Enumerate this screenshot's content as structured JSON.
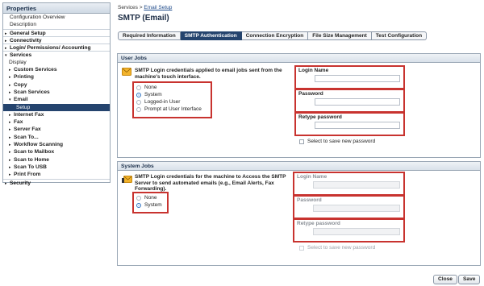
{
  "sidebar": {
    "title": "Properties",
    "items": [
      {
        "label": "Configuration Overview",
        "level": "plain"
      },
      {
        "label": "Description",
        "level": "plain"
      },
      {
        "label": "General Setup",
        "level": "top",
        "marker": "▸"
      },
      {
        "label": "Connectivity",
        "level": "top",
        "marker": "▸"
      },
      {
        "label": "Login/ Permissions/ Accounting",
        "level": "top",
        "marker": "▸"
      },
      {
        "label": "Services",
        "level": "top",
        "marker": "▾"
      },
      {
        "label": "Display",
        "level": "sub"
      },
      {
        "label": "Custom Services",
        "level": "sub-bold",
        "marker": "▸"
      },
      {
        "label": "Printing",
        "level": "sub-bold",
        "marker": "▸"
      },
      {
        "label": "Copy",
        "level": "sub-bold",
        "marker": "▸"
      },
      {
        "label": "Scan Services",
        "level": "sub-bold",
        "marker": "▸"
      },
      {
        "label": "Email",
        "level": "sub-bold",
        "marker": "▾"
      },
      {
        "label": "Setup",
        "level": "subsub-active"
      },
      {
        "label": "Internet Fax",
        "level": "sub-bold",
        "marker": "▸"
      },
      {
        "label": "Fax",
        "level": "sub-bold",
        "marker": "▸"
      },
      {
        "label": "Server Fax",
        "level": "sub-bold",
        "marker": "▸"
      },
      {
        "label": "Scan To...",
        "level": "sub-bold",
        "marker": "▸"
      },
      {
        "label": "Workflow Scanning",
        "level": "sub-bold",
        "marker": "▸"
      },
      {
        "label": "Scan to Mailbox",
        "level": "sub-bold",
        "marker": "▸"
      },
      {
        "label": "Scan to Home",
        "level": "sub-bold",
        "marker": "▸"
      },
      {
        "label": "Scan To USB",
        "level": "sub-bold",
        "marker": "▸"
      },
      {
        "label": "Print From",
        "level": "sub-bold",
        "marker": "▸"
      },
      {
        "label": "Security",
        "level": "top",
        "marker": "▸"
      }
    ]
  },
  "breadcrumb": {
    "root": "Services",
    "separator": ">",
    "current": "Email Setup"
  },
  "page_title": "SMTP (Email)",
  "tabs": [
    {
      "label": "Required Information",
      "active": false
    },
    {
      "label": "SMTP Authentication",
      "active": true
    },
    {
      "label": "Connection Encryption",
      "active": false
    },
    {
      "label": "File Size Management",
      "active": false
    },
    {
      "label": "Test Configuration",
      "active": false
    }
  ],
  "user_jobs": {
    "title": "User Jobs",
    "icon": "envelope-icon",
    "description": "SMTP Login credentials applied to email jobs sent from the machine's touch interface.",
    "options": [
      {
        "label": "None",
        "selected": false
      },
      {
        "label": "System",
        "selected": true
      },
      {
        "label": "Logged-in User",
        "selected": false
      },
      {
        "label": "Prompt at User Interface",
        "selected": false
      }
    ],
    "fields": [
      {
        "label": "Login Name",
        "value": ""
      },
      {
        "label": "Password",
        "value": ""
      },
      {
        "label": "Retype password",
        "value": ""
      }
    ],
    "save_password_label": "Select to save new password"
  },
  "system_jobs": {
    "title": "System Jobs",
    "icon": "warning-envelope-icon",
    "description": "SMTP Login credentials for the machine to Access the SMTP Server to send automated emails (e.g., Email Alerts, Fax Forwarding).",
    "options": [
      {
        "label": "None",
        "selected": false
      },
      {
        "label": "System",
        "selected": true
      }
    ],
    "fields": [
      {
        "label": "Login Name",
        "value": ""
      },
      {
        "label": "Password",
        "value": ""
      },
      {
        "label": "Retype password",
        "value": ""
      }
    ],
    "save_password_label": "Select to save new password"
  },
  "buttons": {
    "close": "Close",
    "save": "Save"
  },
  "colors": {
    "accent": "#25446e",
    "highlight_border": "#c8332f",
    "radio_selected": "#2f7fd8"
  }
}
